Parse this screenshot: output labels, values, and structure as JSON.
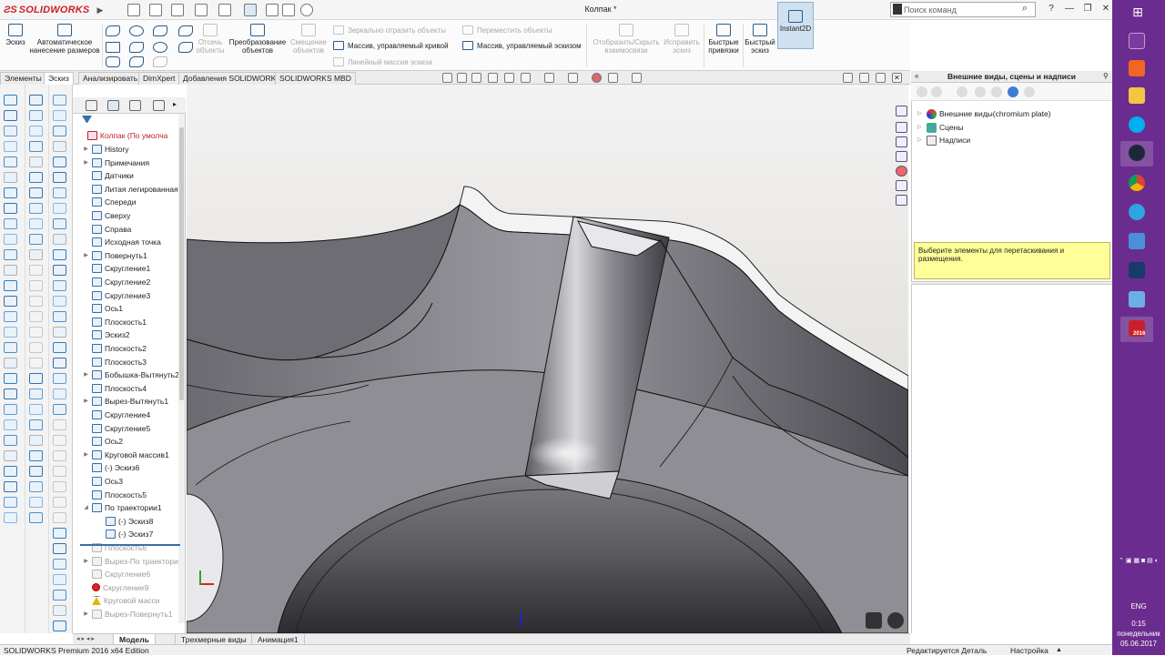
{
  "titlebar": {
    "app_name": "SOLIDWORKS",
    "document_title": "Колпак *",
    "search_placeholder": "Поиск команд",
    "help_label": "?"
  },
  "ribbon": {
    "sketch": "Эскиз",
    "smart_dimension": "Автоматическое нанесение размеров",
    "trim": "Отсечь объекты",
    "convert": "Преобразование объектов",
    "offset": "Смещение объектов",
    "mirror": "Зеркально отразить объекты",
    "curve_pattern": "Массив, управляемый кривой",
    "linear_pattern": "Линейный массив эскиза",
    "move": "Переместить объекты",
    "sketch_pattern": "Массив, управляемый эскизом",
    "show_relations": "Отобразить/Скрыть взаимосвязи",
    "repair": "Исправить эскиз",
    "quick_snaps": "Быстрые привязки",
    "rapid_sketch": "Быстрый эскиз",
    "instant2d": "Instant2D"
  },
  "command_tabs": [
    "Элементы",
    "Эскиз",
    "Анализировать",
    "DimXpert",
    "Добавления SOLIDWORKS",
    "SOLIDWORKS MBD"
  ],
  "active_command_tab": "Эскиз",
  "feature_tree": {
    "root": "Колпак  (По умолча",
    "items": [
      {
        "label": "History",
        "twisty": true,
        "state": "normal"
      },
      {
        "label": "Примечания",
        "twisty": true,
        "state": "normal"
      },
      {
        "label": "Датчики",
        "twisty": false,
        "state": "normal"
      },
      {
        "label": "Литая легированная",
        "twisty": false,
        "state": "normal"
      },
      {
        "label": "Спереди",
        "twisty": false,
        "state": "normal"
      },
      {
        "label": "Сверху",
        "twisty": false,
        "state": "normal"
      },
      {
        "label": "Справа",
        "twisty": false,
        "state": "normal"
      },
      {
        "label": "Исходная точка",
        "twisty": false,
        "state": "normal"
      },
      {
        "label": "Повернуть1",
        "twisty": true,
        "state": "normal"
      },
      {
        "label": "Скругление1",
        "twisty": false,
        "state": "normal"
      },
      {
        "label": "Скругление2",
        "twisty": false,
        "state": "normal"
      },
      {
        "label": "Скругление3",
        "twisty": false,
        "state": "normal"
      },
      {
        "label": "Ось1",
        "twisty": false,
        "state": "normal"
      },
      {
        "label": "Плоскость1",
        "twisty": false,
        "state": "normal"
      },
      {
        "label": "Эскиз2",
        "twisty": false,
        "state": "normal"
      },
      {
        "label": "Плоскость2",
        "twisty": false,
        "state": "normal"
      },
      {
        "label": "Плоскость3",
        "twisty": false,
        "state": "normal"
      },
      {
        "label": "Бобышка-Вытянуть2",
        "twisty": true,
        "state": "normal"
      },
      {
        "label": "Плоскость4",
        "twisty": false,
        "state": "normal"
      },
      {
        "label": "Вырез-Вытянуть1",
        "twisty": true,
        "state": "normal"
      },
      {
        "label": "Скругление4",
        "twisty": false,
        "state": "normal"
      },
      {
        "label": "Скругление5",
        "twisty": false,
        "state": "normal"
      },
      {
        "label": "Ось2",
        "twisty": false,
        "state": "normal"
      },
      {
        "label": "Круговой массив1",
        "twisty": true,
        "state": "normal"
      },
      {
        "label": "(-) Эскиз6",
        "twisty": false,
        "state": "normal"
      },
      {
        "label": "Ось3",
        "twisty": false,
        "state": "normal"
      },
      {
        "label": "Плоскость5",
        "twisty": false,
        "state": "normal"
      },
      {
        "label": "По траектории1",
        "twisty": true,
        "state": "open"
      },
      {
        "label": "(-) Эскиз8",
        "twisty": false,
        "state": "child"
      },
      {
        "label": "(-) Эскиз7",
        "twisty": false,
        "state": "child"
      },
      {
        "label": "Плоскость6",
        "twisty": false,
        "state": "sup"
      },
      {
        "label": "Вырез-По траектори",
        "twisty": true,
        "state": "sup"
      },
      {
        "label": "Скругление6",
        "twisty": false,
        "state": "sup"
      },
      {
        "label": "Скругление9",
        "twisty": false,
        "state": "err"
      },
      {
        "label": "Круговой масси",
        "twisty": false,
        "state": "warn"
      },
      {
        "label": "Вырез-Повернуть1",
        "twisty": true,
        "state": "sup"
      }
    ]
  },
  "task_pane": {
    "title": "Внешние виды, сцены и надписи",
    "items": [
      "Внешние виды(chromium plate)",
      "Сцены",
      "Надписи"
    ],
    "message": "Выберите элементы для перетаскивания и размещения."
  },
  "bottom_tabs": [
    "Модель",
    "Трехмерные виды",
    "Анимация1"
  ],
  "active_bottom_tab": "Модель",
  "status": {
    "edition": "SOLIDWORKS Premium 2016 x64 Edition",
    "editing": "Редактируется Деталь",
    "custom": "Настройка"
  },
  "taskbar": {
    "lang": "ENG",
    "time": "0:15",
    "day": "понедельник",
    "date": "05.06.2017",
    "sw_badge": "2016"
  },
  "colors": {
    "accent": "#2a5b8c",
    "taskbar": "#6b2c8f",
    "brand_red": "#d0202a",
    "message_bg": "#ffff99"
  }
}
